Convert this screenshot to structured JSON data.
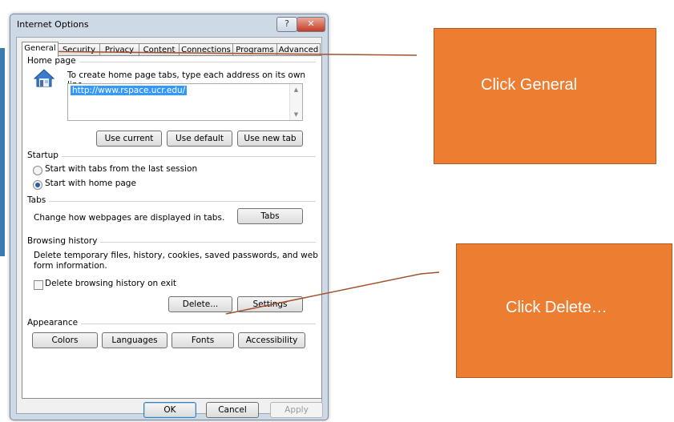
{
  "window": {
    "title": "Internet Options",
    "help_label": "?",
    "close_label": "✕"
  },
  "tabs": [
    "General",
    "Security",
    "Privacy",
    "Content",
    "Connections",
    "Programs",
    "Advanced"
  ],
  "home_page": {
    "group_label": "Home page",
    "description": "To create home page tabs, type each address on its own line.",
    "url": "http://www.rspace.ucr.edu/",
    "buttons": [
      "Use current",
      "Use default",
      "Use new tab"
    ]
  },
  "startup": {
    "group_label": "Startup",
    "options": [
      {
        "label": "Start with tabs from the last session",
        "selected": false
      },
      {
        "label": "Start with home page",
        "selected": true
      }
    ]
  },
  "tabs_group": {
    "group_label": "Tabs",
    "description": "Change how webpages are displayed in tabs.",
    "button": "Tabs"
  },
  "browsing_history": {
    "group_label": "Browsing history",
    "description_line1": "Delete temporary files, history, cookies, saved passwords, and web",
    "description_line2": "form information.",
    "checkbox_label": "Delete browsing history on exit",
    "checkbox_checked": false,
    "delete_button": "Delete...",
    "settings_button": "Settings"
  },
  "appearance": {
    "group_label": "Appearance",
    "buttons": [
      "Colors",
      "Languages",
      "Fonts",
      "Accessibility"
    ]
  },
  "dialog_buttons": {
    "ok": "OK",
    "cancel": "Cancel",
    "apply": "Apply"
  },
  "callouts": {
    "general": "Click General",
    "delete": "Click Delete…"
  },
  "colors": {
    "callout_fill": "#ed7d31",
    "pointer_line": "#a0522d",
    "selection": "#3399ff"
  }
}
